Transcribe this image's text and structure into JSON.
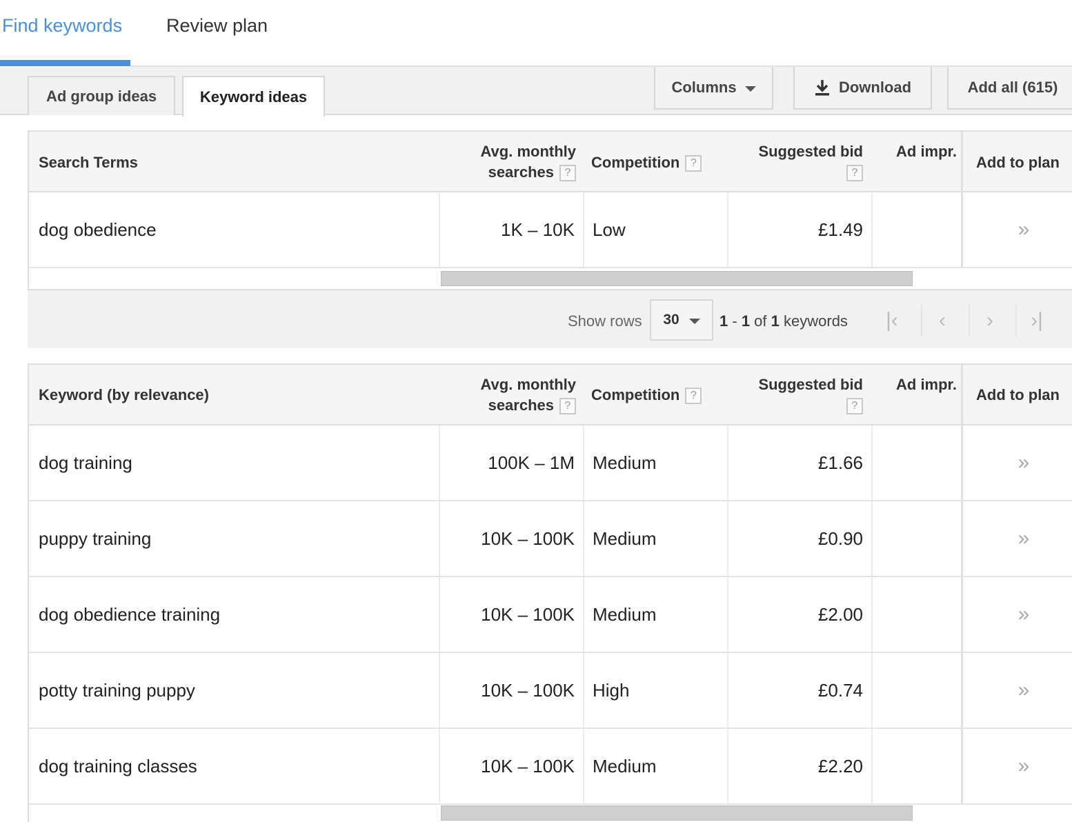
{
  "nav": {
    "find_keywords": "Find keywords",
    "review_plan": "Review plan"
  },
  "toolbar": {
    "ad_group_ideas": "Ad group ideas",
    "keyword_ideas": "Keyword ideas",
    "columns": "Columns",
    "download": "Download",
    "add_all": "Add all (615)"
  },
  "search_table": {
    "headers": {
      "term": "Search Terms",
      "avg_line1": "Avg. monthly",
      "avg_line2": "searches",
      "competition": "Competition",
      "bid": "Suggested bid",
      "impr": "Ad impr.",
      "add": "Add to plan",
      "help": "?"
    },
    "rows": [
      {
        "term": "dog obedience",
        "searches": "1K – 10K",
        "competition": "Low",
        "bid": "£1.49",
        "add": "»"
      }
    ]
  },
  "pager": {
    "show_rows": "Show rows",
    "rows_value": "30",
    "range_start": "1",
    "range_sep": " - ",
    "range_end": "1",
    "of": " of ",
    "total": "1",
    "unit": " keywords",
    "first": "|‹",
    "prev": "‹",
    "next": "›",
    "last": "›|"
  },
  "keyword_table": {
    "headers": {
      "term": "Keyword (by relevance)",
      "avg_line1": "Avg. monthly",
      "avg_line2": "searches",
      "competition": "Competition",
      "bid": "Suggested bid",
      "impr": "Ad impr.",
      "add": "Add to plan",
      "help": "?"
    },
    "rows": [
      {
        "term": "dog training",
        "searches": "100K – 1M",
        "competition": "Medium",
        "bid": "£1.66",
        "add": "»"
      },
      {
        "term": "puppy training",
        "searches": "10K – 100K",
        "competition": "Medium",
        "bid": "£0.90",
        "add": "»"
      },
      {
        "term": "dog obedience training",
        "searches": "10K – 100K",
        "competition": "Medium",
        "bid": "£2.00",
        "add": "»"
      },
      {
        "term": "potty training puppy",
        "searches": "10K – 100K",
        "competition": "High",
        "bid": "£0.74",
        "add": "»"
      },
      {
        "term": "dog training classes",
        "searches": "10K – 100K",
        "competition": "Medium",
        "bid": "£2.20",
        "add": "»"
      }
    ]
  },
  "colors": {
    "accent": "#4a90d9"
  }
}
